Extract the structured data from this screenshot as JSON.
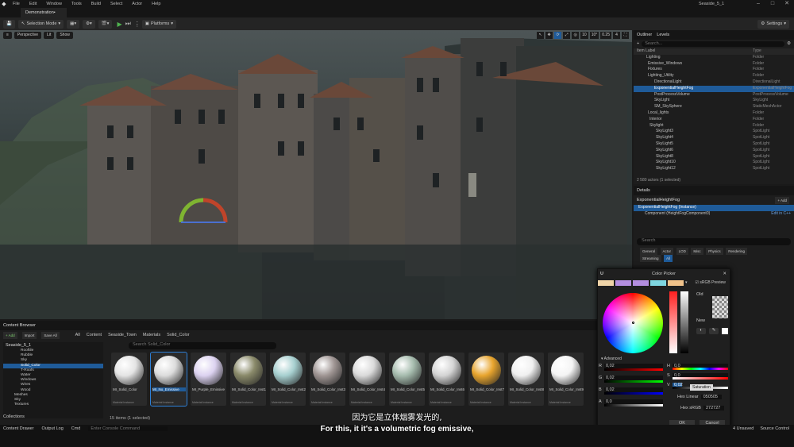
{
  "menu": {
    "items": [
      "File",
      "Edit",
      "Window",
      "Tools",
      "Build",
      "Select",
      "Actor",
      "Help"
    ]
  },
  "tab": {
    "label": "Demonstration•"
  },
  "project": {
    "name": "Seaside_5_1"
  },
  "toolbar": {
    "save": "Save",
    "mode": "Selection Mode",
    "platforms": "Platforms",
    "settings": "Settings"
  },
  "viewport": {
    "perspective": "Perspective",
    "lit": "Lit",
    "show": "Show",
    "right": [
      "10",
      "10°",
      "0.25",
      "4"
    ]
  },
  "outliner": {
    "tab1": "Outliner",
    "tab2": "Levels",
    "search_placeholder": "Search...",
    "col1": "Item Label",
    "col2": "Type",
    "rows": [
      {
        "l": "Lighting",
        "t": "Folder"
      },
      {
        "l": "Emissive_Windows",
        "t": "Folder"
      },
      {
        "l": "Fixtures",
        "t": "Folder"
      },
      {
        "l": "Lighting_Utility",
        "t": "Folder"
      },
      {
        "l": "DirectionalLight",
        "t": "DirectionalLight"
      },
      {
        "l": "ExponentialHeightFog",
        "t": "ExponentialHeightFog"
      },
      {
        "l": "PostProcessVolume",
        "t": "PostProcessVolume"
      },
      {
        "l": "SkyLight",
        "t": "SkyLight"
      },
      {
        "l": "SM_SkySphere",
        "t": "StaticMeshActor"
      },
      {
        "l": "Local_lights",
        "t": "Folder"
      },
      {
        "l": "Interior",
        "t": "Folder"
      },
      {
        "l": "Skylight",
        "t": "Folder"
      },
      {
        "l": "SkyLight3",
        "t": "SpotLight"
      },
      {
        "l": "SkyLight4",
        "t": "SpotLight"
      },
      {
        "l": "SkyLight5",
        "t": "SpotLight"
      },
      {
        "l": "SkyLight6",
        "t": "SpotLight"
      },
      {
        "l": "SkyLight8",
        "t": "SpotLight"
      },
      {
        "l": "SkyLight10",
        "t": "SpotLight"
      },
      {
        "l": "SkyLight12",
        "t": "SpotLight"
      }
    ],
    "count": "2 580 actors (1 selected)"
  },
  "details": {
    "title": "Details",
    "actor": "ExponentialHeightFog",
    "add": "+ Add",
    "instance": "ExponentialHeightFog (Instance)",
    "component": "Component (HeightFogComponent0)",
    "edit": "Edit in C++",
    "search_placeholder": "Search",
    "filters": [
      "General",
      "Actor",
      "LOD",
      "Misc",
      "Physics",
      "Rendering",
      "Streaming",
      "All"
    ]
  },
  "content": {
    "title": "Content Browser",
    "add": "+ Add",
    "import": "Import",
    "saveall": "Save All",
    "path": [
      "All",
      "Content",
      "Seaside_Town",
      "Materials",
      "Solid_Color"
    ],
    "search_placeholder": "Search Solid_Color",
    "root": "Seaside_5_1",
    "folders": [
      "Rooftile",
      "Rubble",
      "Sky",
      "Solid_Color",
      "T-Roofs",
      "Water",
      "Windows",
      "Wires",
      "Wood",
      "Meshes",
      "Sky",
      "Textures"
    ],
    "collections": "Collections",
    "count": "15 items (1 selected)",
    "tiles": [
      {
        "n": "MI_Solid_Color",
        "c": "#e4e4e4"
      },
      {
        "n": "MI_No_Emissive",
        "c": "#dcdcdc"
      },
      {
        "n": "MI_Purple_Emissive",
        "c": "#dcd2f0"
      },
      {
        "n": "MI_Solid_Color_Inst1",
        "c": "#8a8a6a"
      },
      {
        "n": "MI_Solid_Color_Inst2",
        "c": "#a7d0d0"
      },
      {
        "n": "MI_Solid_Color_Inst3",
        "c": "#a09694"
      },
      {
        "n": "MI_Solid_Color_Inst4",
        "c": "#dadada"
      },
      {
        "n": "MI_Solid_Color_Inst5",
        "c": "#a6bcae"
      },
      {
        "n": "MI_Solid_Color_Inst6",
        "c": "#d4d4d4"
      },
      {
        "n": "MI_Solid_Color_Inst7",
        "c": "#e8a52e"
      },
      {
        "n": "MI_Solid_Color_Inst8",
        "c": "#f0f0f0"
      },
      {
        "n": "MI_Solid_Color_Inst9",
        "c": "#f4f4f4"
      }
    ],
    "stype": "Material Instance"
  },
  "colorpicker": {
    "title": "Color Picker",
    "srgb": "sRGB Preview",
    "old": "Old",
    "new": "New",
    "advanced": "Advanced",
    "r": "0,02",
    "g": "0,02",
    "b": "0,02",
    "a": "0,0",
    "h": "0,0",
    "s": "0,0",
    "v": "0,02",
    "tooltip": "Saturation",
    "hexlinear_label": "Hex Linear",
    "hexlinear": "050505",
    "hexsrgb_label": "Hex sRGB",
    "hexsrgb": "272727",
    "ok": "OK",
    "cancel": "Cancel"
  },
  "bottom": {
    "drawer": "Content Drawer",
    "log": "Output Log",
    "cmd": "Cmd",
    "console": "Enter Console Command",
    "unsaved": "4 Unsaved",
    "source": "Source Control"
  },
  "subtitle": {
    "cn": "因为它是立体烟雾发光的,",
    "en": "For this, it it's a volumetric fog emissive,"
  }
}
